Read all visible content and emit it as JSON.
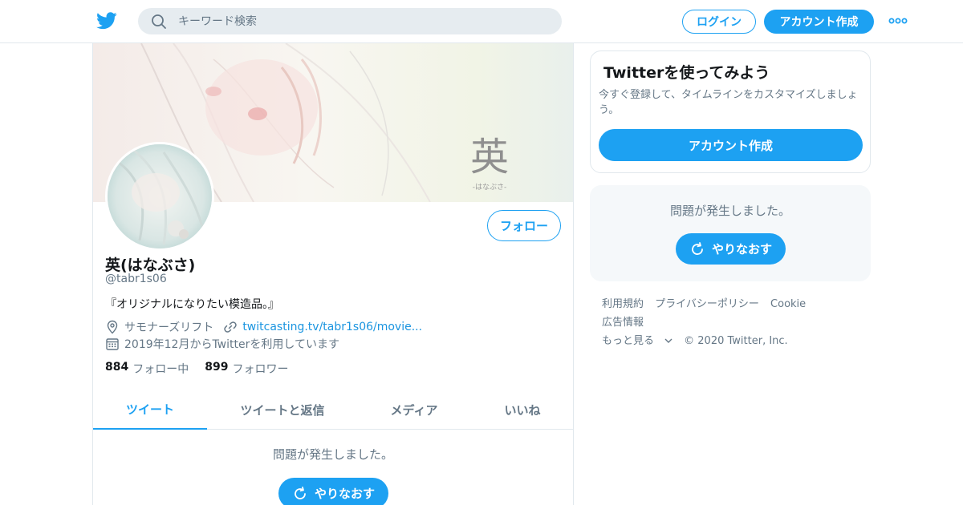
{
  "nav": {
    "search_placeholder": "キーワード検索",
    "login_label": "ログイン",
    "signup_label": "アカウント作成"
  },
  "profile": {
    "display_name": "英(はなぶさ)",
    "handle": "@tabr1s06",
    "bio": "『オリジナルになりたい模造品。』",
    "location": "サモナーズリフト",
    "url": "twitcasting.tv/tabr1s06/movie...",
    "joined": "2019年12月からTwitterを利用しています",
    "following_count": "884",
    "following_label": "フォロー中",
    "followers_count": "899",
    "followers_label": "フォロワー",
    "follow_label": "フォロー",
    "banner_text": "英",
    "banner_subtext": "-はなぶさ-"
  },
  "tabs": [
    {
      "label": "ツイート"
    },
    {
      "label": "ツイートと返信"
    },
    {
      "label": "メディア"
    },
    {
      "label": "いいね"
    }
  ],
  "timeline": {
    "error_text": "問題が発生しました。",
    "retry_label": "やりなおす"
  },
  "sidebar": {
    "signup_title": "Twitterを使ってみよう",
    "signup_desc": "今すぐ登録して、タイムラインをカスタマイズしましょう。",
    "signup_button": "アカウント作成",
    "error_text": "問題が発生しました。",
    "retry_label": "やりなおす"
  },
  "footer": {
    "terms": "利用規約",
    "privacy": "プライバシーポリシー",
    "cookie": "Cookie",
    "ads": "広告情報",
    "more": "もっと見る",
    "copyright": "© 2020 Twitter, Inc."
  },
  "colors": {
    "accent": "#1da1f2",
    "muted_text": "#657786",
    "border": "#e1e8ed"
  },
  "icons": [
    "twitter-bird-icon",
    "search-icon",
    "more-dots-icon",
    "location-icon",
    "link-icon",
    "calendar-icon",
    "retry-icon",
    "chevron-down-icon"
  ]
}
